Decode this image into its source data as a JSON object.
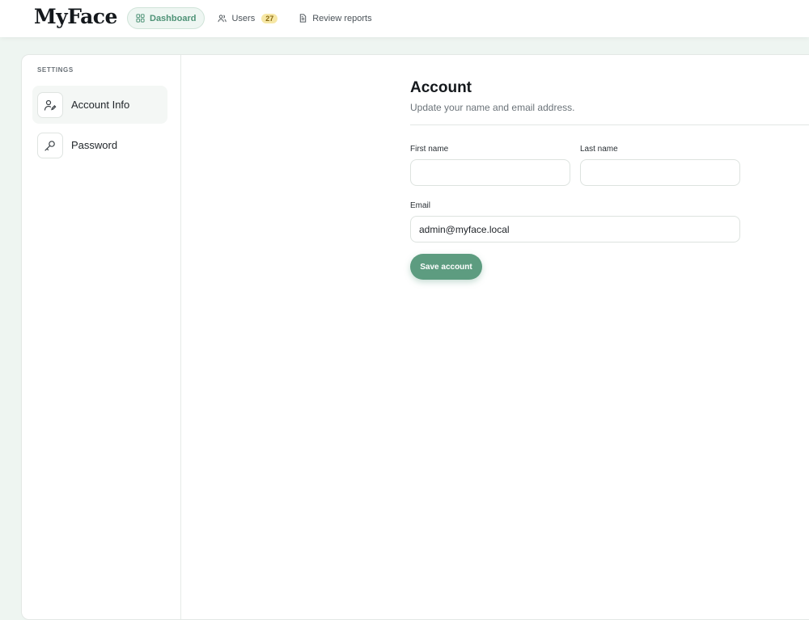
{
  "app": {
    "brand": "MyFace"
  },
  "nav": {
    "items": [
      {
        "label": "Dashboard",
        "icon": "dashboard-icon",
        "active": true
      },
      {
        "label": "Users",
        "icon": "users-icon",
        "badge": "27"
      },
      {
        "label": "Review reports",
        "icon": "document-icon"
      }
    ]
  },
  "sidebar": {
    "section_label": "SETTINGS",
    "items": [
      {
        "label": "Account Info",
        "icon": "user-edit-icon",
        "active": true
      },
      {
        "label": "Password",
        "icon": "key-icon"
      }
    ]
  },
  "form": {
    "title": "Account",
    "subtitle": "Update your name and email address.",
    "first_name_label": "First name",
    "first_name_value": "",
    "last_name_label": "Last name",
    "last_name_value": "",
    "email_label": "Email",
    "email_value": "admin@myface.local",
    "save_label": "Save account"
  },
  "colors": {
    "accent": "#5d9c80",
    "accent_text": "#4f9377",
    "badge_bg": "#f6e7a5",
    "page_bg": "#eef5f1"
  }
}
